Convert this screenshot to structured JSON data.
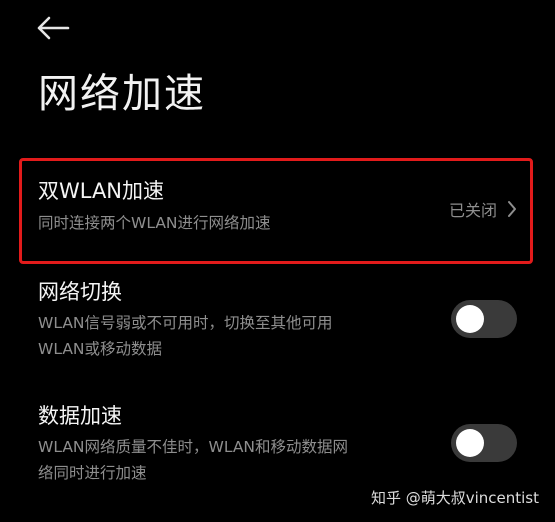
{
  "page_title": "网络加速",
  "items": [
    {
      "title": "双WLAN加速",
      "desc_lines": [
        "同时连接两个WLAN进行网络加速"
      ],
      "status": "已关闭",
      "control": "chevron"
    },
    {
      "title": "网络切换",
      "desc_lines": [
        "WLAN信号弱或不可用时，切换至其他可用",
        "WLAN或移动数据"
      ],
      "control": "toggle",
      "toggle_on": false
    },
    {
      "title": "数据加速",
      "desc_lines": [
        "WLAN网络质量不佳时，WLAN和移动数据网",
        "络同时进行加速"
      ],
      "control": "toggle",
      "toggle_on": false
    }
  ],
  "watermark": "知乎 @萌大叔vincentist",
  "colors": {
    "background": "#000000",
    "highlight_border": "#e21b1b",
    "toggle_track": "#3a3a3a",
    "secondary_text": "#8e8e8e"
  }
}
